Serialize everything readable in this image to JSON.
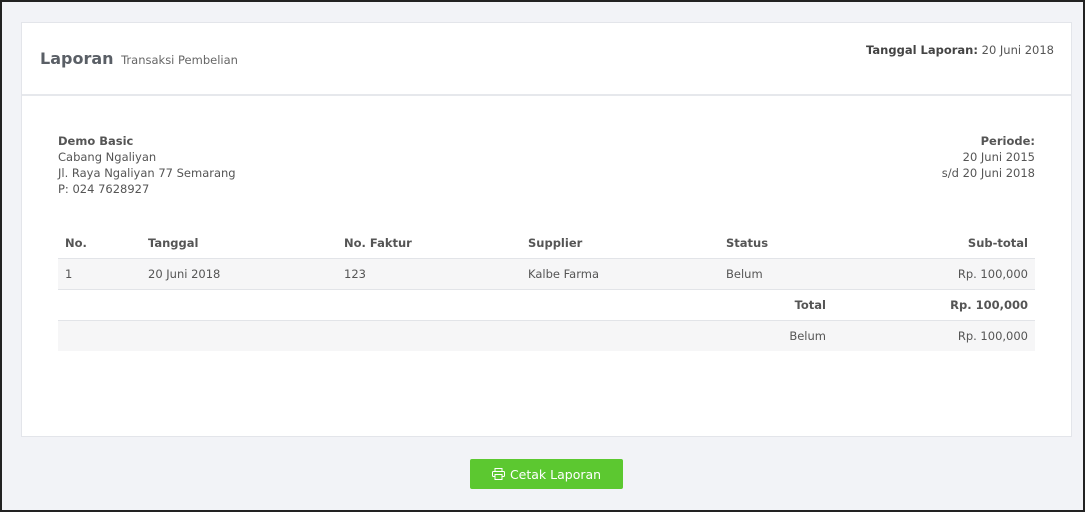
{
  "header": {
    "title": "Laporan",
    "subtitle": "Transaksi Pembelian",
    "date_label": "Tanggal Laporan:",
    "date_value": "20 Juni 2018"
  },
  "company": {
    "name": "Demo Basic",
    "branch": "Cabang Ngaliyan",
    "address": "Jl. Raya Ngaliyan 77 Semarang",
    "phone": "P: 024 7628927"
  },
  "period": {
    "label": "Periode:",
    "start": "20 Juni 2015",
    "end": "s/d 20 Juni 2018"
  },
  "table": {
    "columns": [
      "No.",
      "Tanggal",
      "No. Faktur",
      "Supplier",
      "Status",
      "Sub-total"
    ],
    "rows": [
      {
        "no": "1",
        "tanggal": "20 Juni 2018",
        "faktur": "123",
        "supplier": "Kalbe Farma",
        "status": "Belum",
        "subtotal": "Rp. 100,000"
      }
    ],
    "total_label": "Total",
    "total_value": "Rp. 100,000",
    "summary_status": "Belum",
    "summary_value": "Rp. 100,000"
  },
  "actions": {
    "print_label": "Cetak Laporan",
    "print_icon": "printer-icon"
  }
}
